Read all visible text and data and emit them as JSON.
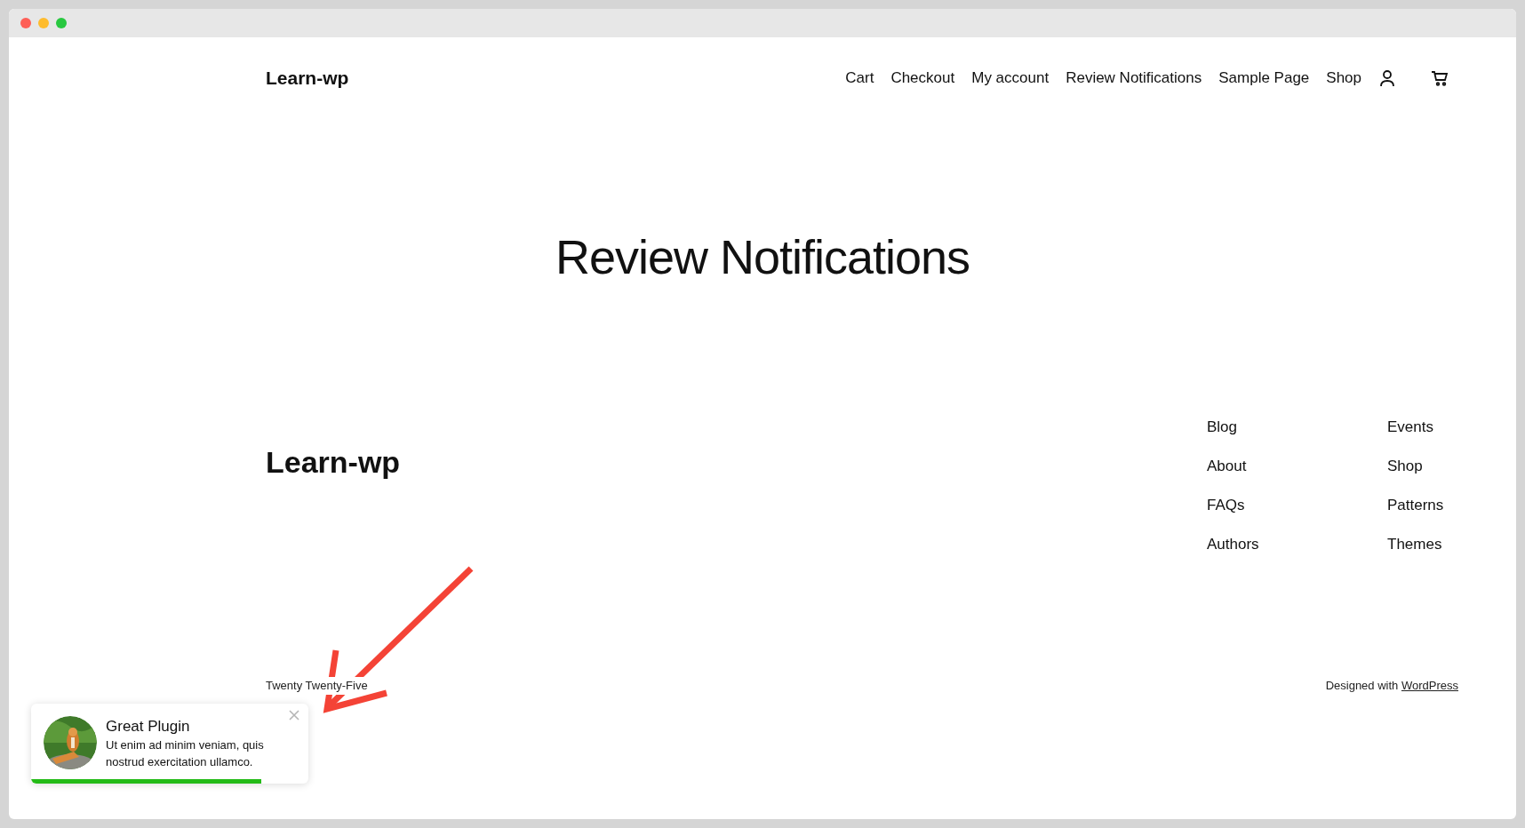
{
  "header": {
    "site_title": "Learn-wp",
    "nav": [
      "Cart",
      "Checkout",
      "My account",
      "Review Notifications",
      "Sample Page",
      "Shop"
    ]
  },
  "page_title": "Review Notifications",
  "footer": {
    "site_title": "Learn-wp",
    "columns": [
      [
        "Blog",
        "About",
        "FAQs",
        "Authors"
      ],
      [
        "Events",
        "Shop",
        "Patterns",
        "Themes"
      ]
    ],
    "theme_credit": "Twenty Twenty-Five",
    "credit_prefix": "Designed with",
    "credit_link": "WordPress"
  },
  "toast": {
    "title": "Great Plugin",
    "message": "Ut enim ad minim veniam, quis nostrud exercitation ullamco.",
    "level": 0.83
  }
}
